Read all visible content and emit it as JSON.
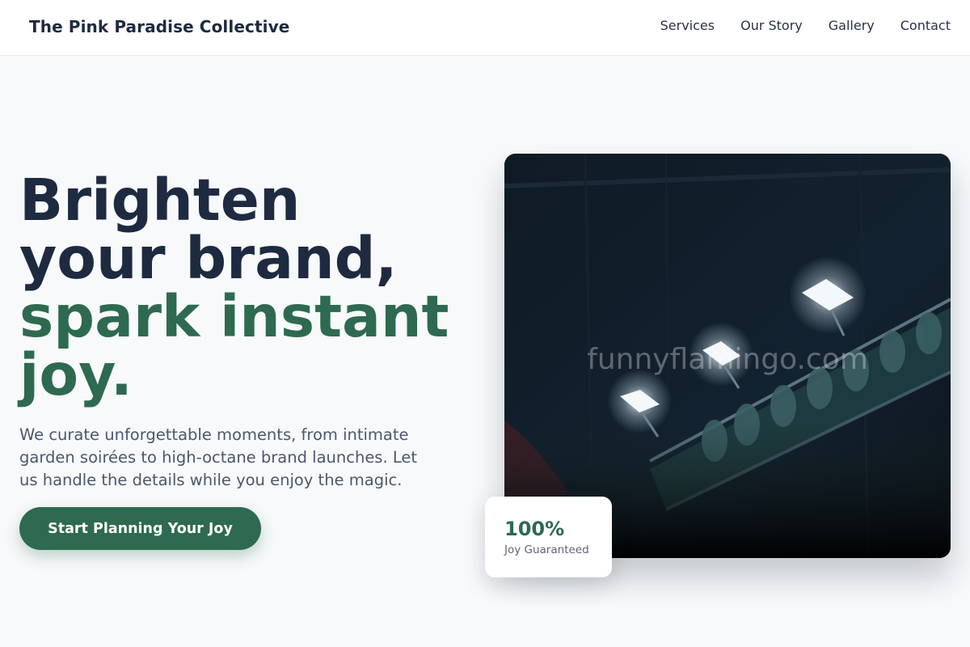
{
  "header": {
    "brand": "The Pink Paradise Collective",
    "nav": [
      "Services",
      "Our Story",
      "Gallery",
      "Contact"
    ]
  },
  "hero": {
    "title_line1": "Brighten",
    "title_line2": "your brand,",
    "title_line3": "spark instant",
    "title_line4": "joy.",
    "subtitle": "We curate unforgettable moments, from intimate garden soirées to high-octane brand launches. Let us handle the details while you enjoy the magic.",
    "cta_label": "Start Planning Your Joy"
  },
  "image": {
    "watermark": "funnyflamingo.com",
    "subject": "stage lights on truss"
  },
  "stat": {
    "value": "100%",
    "label": "Joy Guaranteed"
  },
  "colors": {
    "accent": "#2e6a4f",
    "heading": "#1e2a40",
    "background": "#f7f9fb"
  }
}
